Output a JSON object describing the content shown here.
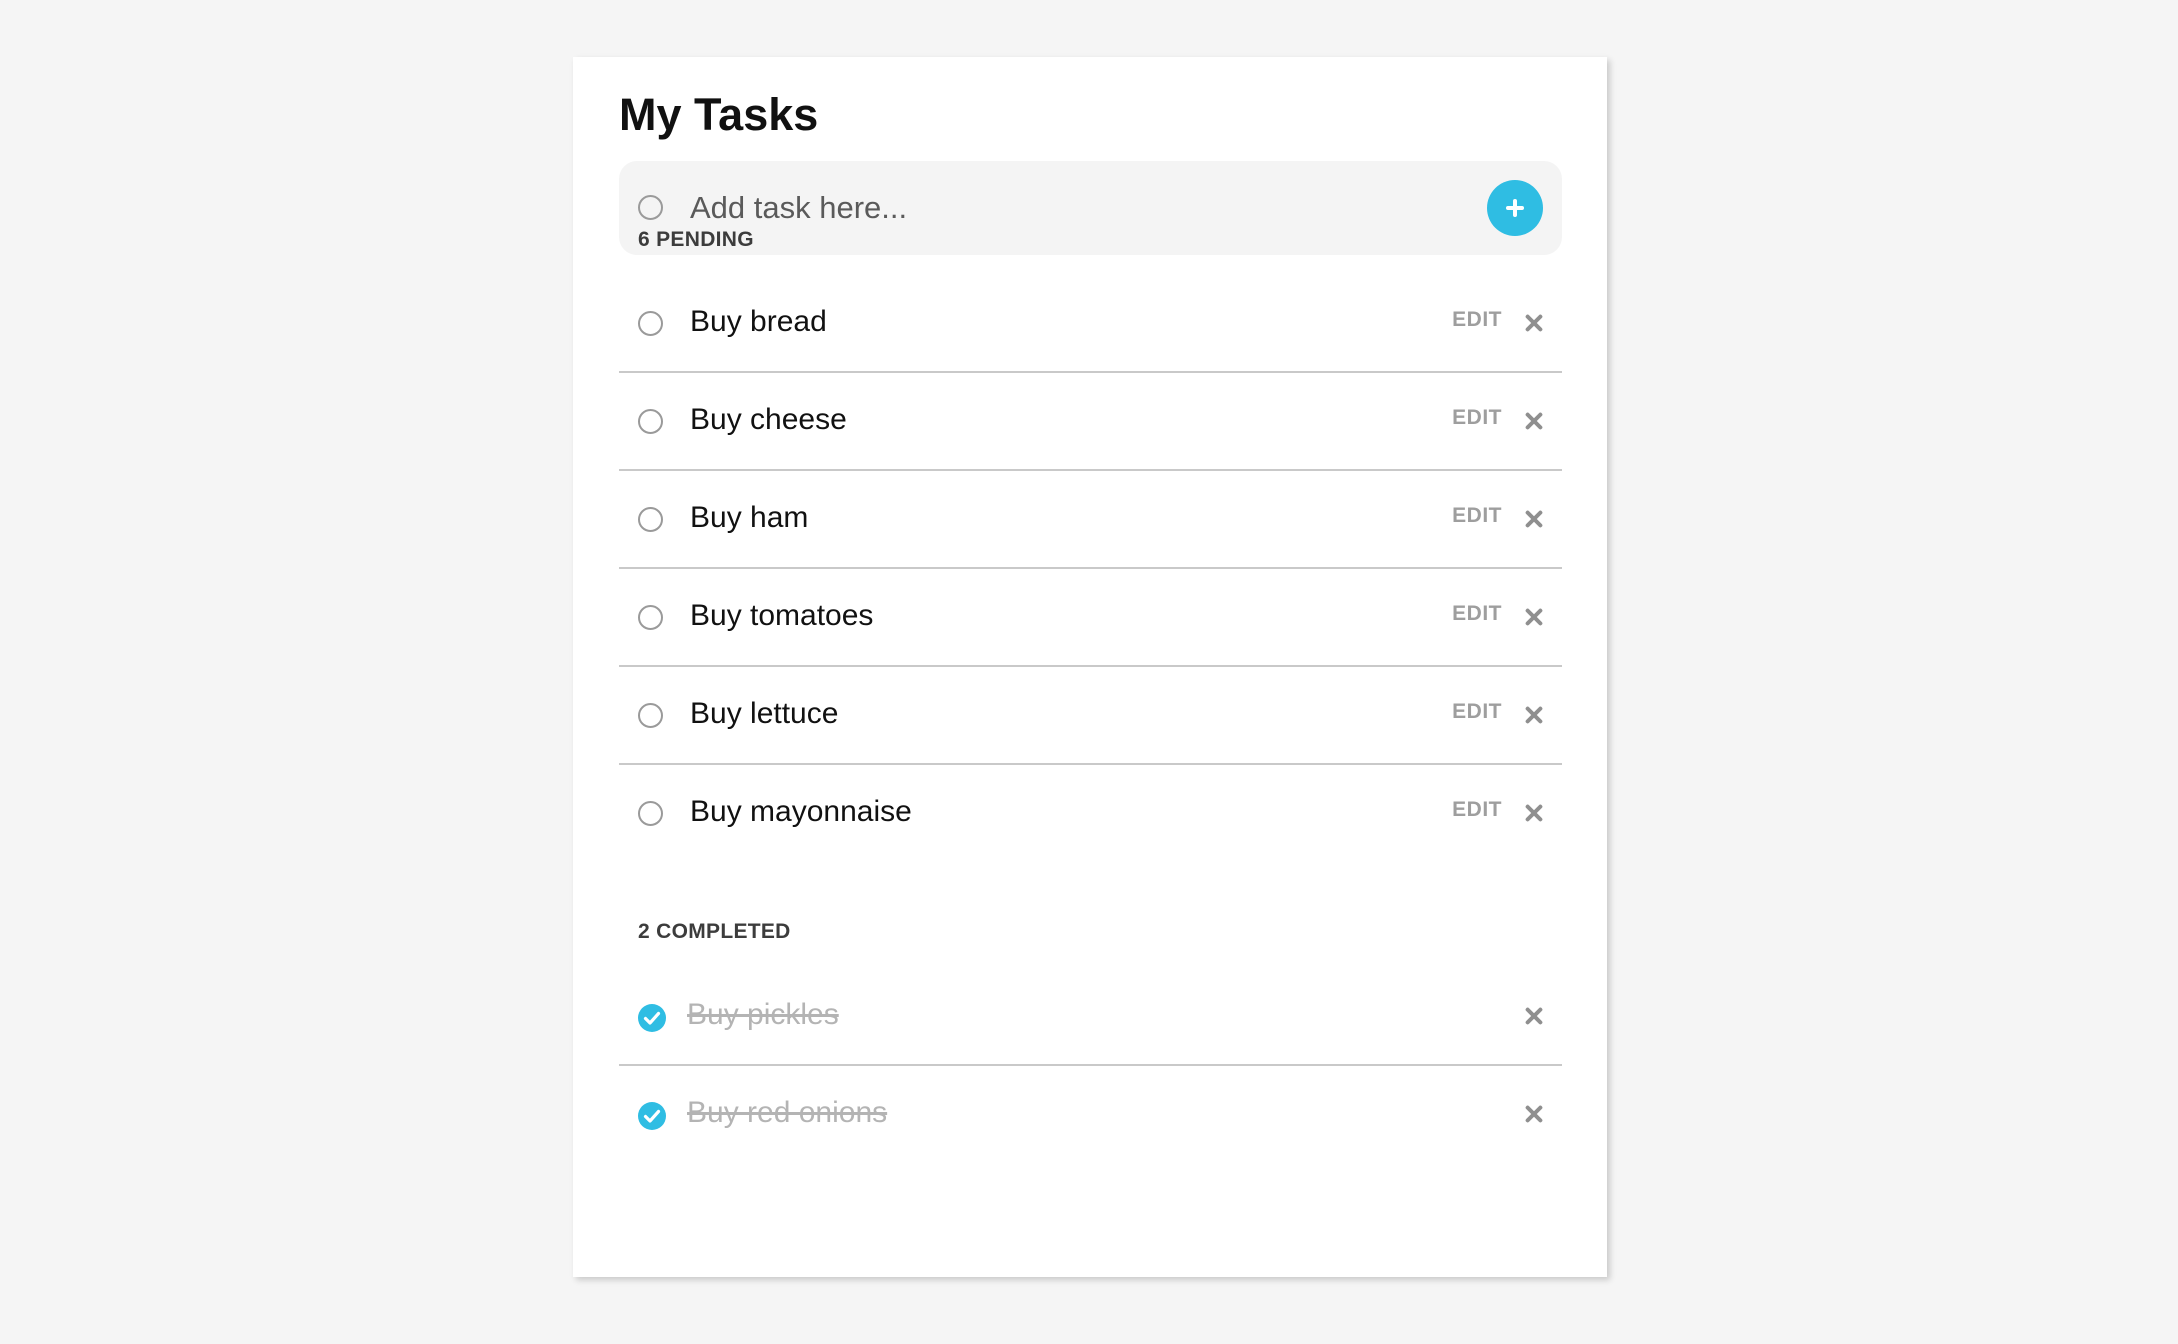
{
  "app": {
    "title": "My Tasks"
  },
  "add_task": {
    "placeholder": "Add task here...",
    "button_icon": "plus-icon"
  },
  "pending": {
    "heading": "6 PENDING",
    "edit_label": "EDIT",
    "items": [
      {
        "label": "Buy bread"
      },
      {
        "label": "Buy cheese"
      },
      {
        "label": "Buy ham"
      },
      {
        "label": "Buy tomatoes"
      },
      {
        "label": "Buy lettuce"
      },
      {
        "label": "Buy mayonnaise"
      }
    ]
  },
  "completed": {
    "heading": "2 COMPLETED",
    "items": [
      {
        "label": "Buy pickles"
      },
      {
        "label": "Buy red onions"
      }
    ]
  },
  "colors": {
    "accent": "#2fbde3",
    "page_background": "#f5f5f5",
    "card_background": "#ffffff",
    "muted_text": "#9e9e9e",
    "completed_text": "#b4b4b4"
  }
}
